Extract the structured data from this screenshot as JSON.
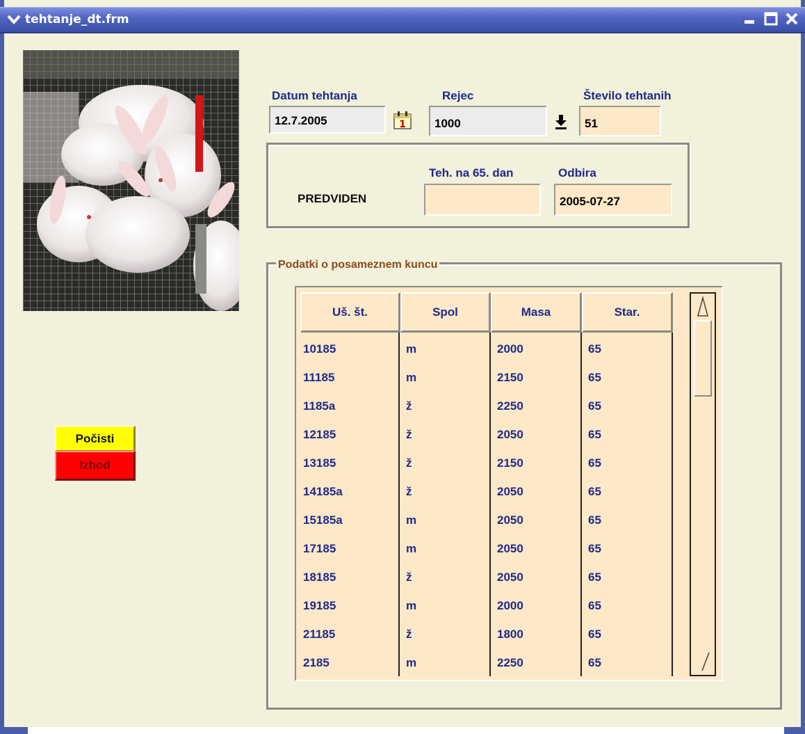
{
  "window": {
    "title": "tehtanje_dt.frm"
  },
  "form": {
    "datum_label": "Datum tehtanja",
    "datum_value": "12.7.2005",
    "rejec_label": "Rejec",
    "rejec_value": "1000",
    "stevilo_label": "Število tehtanih",
    "stevilo_value": "51",
    "predviden_label": "PREDVIDEN",
    "teh65_label": "Teh. na 65. dan",
    "teh65_value": "",
    "odbira_label": "Odbira",
    "odbira_value": "2005-07-27"
  },
  "group": {
    "label": "Podatki o posameznem kuncu"
  },
  "table": {
    "headers": [
      "Uš. št.",
      "Spol",
      "Masa",
      "Star."
    ],
    "rows": [
      [
        "10185",
        "m",
        "2000",
        "65"
      ],
      [
        "11185",
        "m",
        "2150",
        "65"
      ],
      [
        "1185a",
        "ž",
        "2250",
        "65"
      ],
      [
        "12185",
        "ž",
        "2050",
        "65"
      ],
      [
        "13185",
        "ž",
        "2150",
        "65"
      ],
      [
        "14185a",
        "ž",
        "2050",
        "65"
      ],
      [
        "15185a",
        "m",
        "2050",
        "65"
      ],
      [
        "17185",
        "m",
        "2050",
        "65"
      ],
      [
        "18185",
        "ž",
        "2050",
        "65"
      ],
      [
        "19185",
        "m",
        "2000",
        "65"
      ],
      [
        "21185",
        "ž",
        "1800",
        "65"
      ],
      [
        "2185",
        "m",
        "2250",
        "65"
      ]
    ]
  },
  "buttons": {
    "clear_label": "Počisti",
    "exit_label": "Izhod"
  },
  "icons": {
    "calendar": "calendar-icon",
    "dropdown": "download-arrow-icon",
    "menu": "chevron-down-icon",
    "minimize": "minimize-icon",
    "maximize": "maximize-icon",
    "close": "close-icon"
  },
  "colors": {
    "field_peach": "#fde8c8",
    "label_blue": "#1e2a8a",
    "clear_button": "#ffff00",
    "exit_button": "#ff0000"
  }
}
